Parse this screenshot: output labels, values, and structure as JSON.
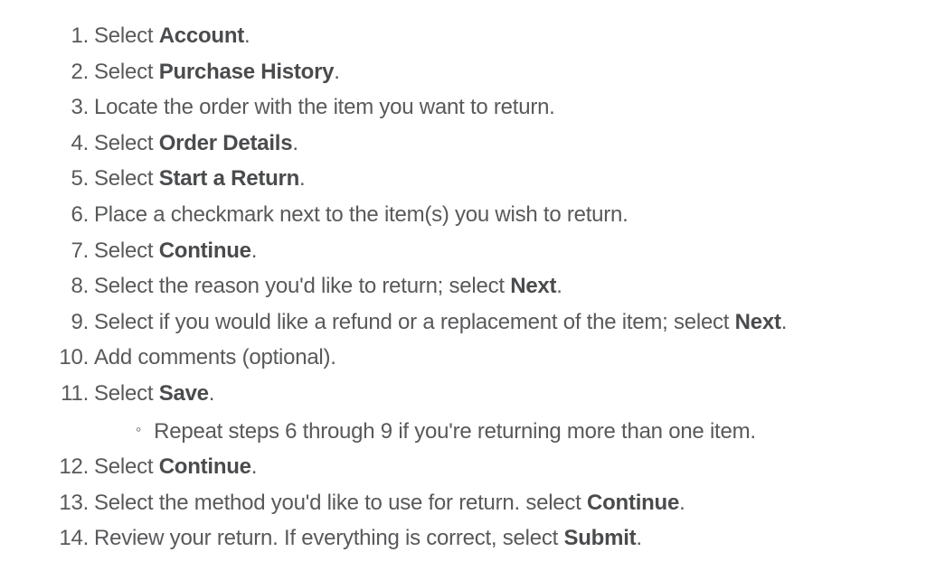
{
  "steps": [
    {
      "html": "Select <strong>Account</strong>."
    },
    {
      "html": "Select <strong>Purchase History</strong>."
    },
    {
      "html": "Locate the order with the item you want to return."
    },
    {
      "html": "Select <strong>Order Details</strong>."
    },
    {
      "html": "Select <strong>Start a Return</strong>."
    },
    {
      "html": "Place a checkmark next to the item(s) you wish to return."
    },
    {
      "html": "Select <strong>Continue</strong>."
    },
    {
      "html": "Select the reason you'd like to return; select <strong>Next</strong>."
    },
    {
      "html": "Select if you would like a refund or a replacement of the item; select <strong>Next</strong>."
    },
    {
      "html": "Add comments (optional)."
    },
    {
      "html": "Select <strong>Save</strong>.",
      "sub": [
        {
          "html": "Repeat steps 6 through 9 if you're returning more than one item."
        }
      ]
    },
    {
      "html": "Select <strong>Continue</strong>."
    },
    {
      "html": "Select the method you'd like to use for return. select <strong>Continue</strong>."
    },
    {
      "html": "Review your return. If everything is correct, select <strong>Submit</strong>."
    }
  ]
}
